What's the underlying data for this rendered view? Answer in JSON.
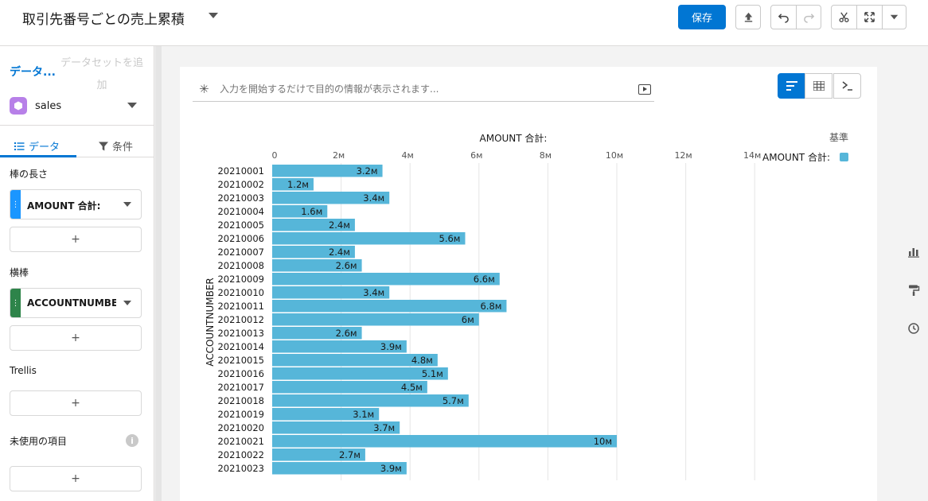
{
  "header": {
    "title": "取引先番号ごとの売上累積",
    "save_label": "保存"
  },
  "left_panel": {
    "dataset_label": "データ...",
    "add_dataset_label": "データセットを追加",
    "dataset_name": "sales",
    "tabs": [
      {
        "label": "データ"
      },
      {
        "label": "条件"
      }
    ],
    "sections": {
      "bar_length": "棒の長さ",
      "bar_length_field": "AMOUNT 合計:",
      "bars": "横棒",
      "bars_field": "ACCOUNTNUMBER",
      "trellis": "Trellis",
      "unused": "未使用の項目"
    },
    "plus": "+",
    "colors": {
      "measure": "#1b96ff",
      "dimension": "#2e844a"
    }
  },
  "search": {
    "placeholder": "入力を開始するだけで目的の情報が表示されます..."
  },
  "chart_data": {
    "type": "bar",
    "orientation": "horizontal",
    "x_axis_title": "AMOUNT 合計:",
    "y_axis_title": "ACCOUNTNUMBER",
    "legend_title": "基準",
    "legend_entry": "AMOUNT 合計:",
    "bar_color": "#56b6d9",
    "xlim": [
      0,
      14
    ],
    "x_ticks": [
      "0",
      "2м",
      "4м",
      "6м",
      "8м",
      "10м",
      "12м",
      "14м"
    ],
    "categories": [
      "20210001",
      "20210002",
      "20210003",
      "20210004",
      "20210005",
      "20210006",
      "20210007",
      "20210008",
      "20210009",
      "20210010",
      "20210011",
      "20210012",
      "20210013",
      "20210014",
      "20210015",
      "20210016",
      "20210017",
      "20210018",
      "20210019",
      "20210020",
      "20210021",
      "20210022",
      "20210023"
    ],
    "values": [
      3.2,
      1.2,
      3.4,
      1.6,
      2.4,
      5.6,
      2.4,
      2.6,
      6.6,
      3.4,
      6.8,
      6,
      2.6,
      3.9,
      4.8,
      5.1,
      4.5,
      5.7,
      3.1,
      3.7,
      10,
      2.7,
      3.9
    ],
    "labels": [
      "3.2м",
      "1.2м",
      "3.4м",
      "1.6м",
      "2.4м",
      "5.6м",
      "2.4м",
      "2.6м",
      "6.6м",
      "3.4м",
      "6.8м",
      "6м",
      "2.6м",
      "3.9м",
      "4.8м",
      "5.1м",
      "4.5м",
      "5.7м",
      "3.1м",
      "3.7м",
      "10м",
      "2.7м",
      "3.9м"
    ],
    "grid": true,
    "legend_position": "top-right",
    "value_unit": "M"
  }
}
